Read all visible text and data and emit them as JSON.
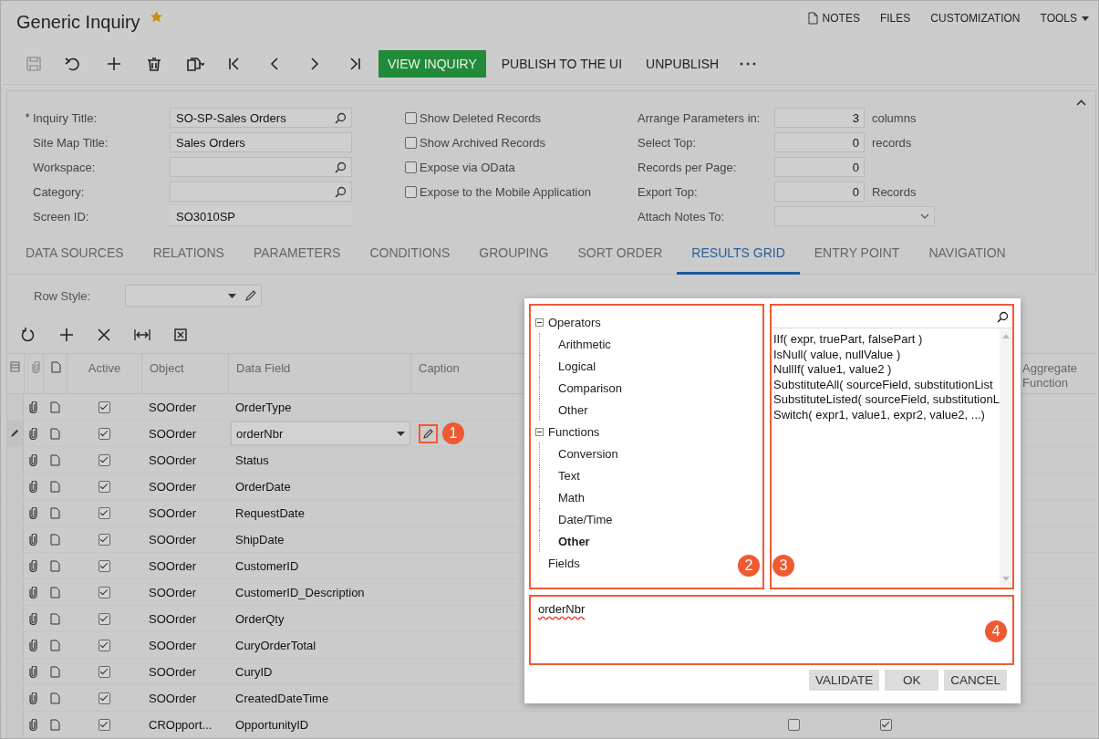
{
  "header": {
    "title": "Generic Inquiry",
    "favorite": true,
    "links": [
      {
        "label": "NOTES",
        "kind": "notes"
      },
      {
        "label": "FILES",
        "kind": "plain"
      },
      {
        "label": "CUSTOMIZATION",
        "kind": "plain"
      },
      {
        "label": "TOOLS",
        "kind": "menu"
      }
    ]
  },
  "toolbar": {
    "icons": [
      {
        "kind": "save",
        "disabled": true
      },
      {
        "kind": "undo",
        "disabled": false
      },
      {
        "kind": "add",
        "disabled": false
      },
      {
        "kind": "delete",
        "disabled": false
      },
      {
        "kind": "paste",
        "disabled": false
      },
      {
        "kind": "first",
        "disabled": false
      },
      {
        "kind": "prev",
        "disabled": false
      },
      {
        "kind": "next",
        "disabled": false
      },
      {
        "kind": "last",
        "disabled": false
      }
    ],
    "actions": [
      {
        "label": "VIEW INQUIRY",
        "kind": "primary"
      },
      {
        "label": "PUBLISH TO THE UI",
        "kind": "plain"
      },
      {
        "label": "UNPUBLISH",
        "kind": "plain"
      },
      {
        "kind": "more"
      }
    ]
  },
  "form": {
    "required_mark": "*",
    "fields": [
      {
        "label": "Inquiry Title:",
        "value": "SO-SP-Sales Orders",
        "required": true,
        "kind": "lookup"
      },
      {
        "label": "Site Map Title:",
        "value": "Sales Orders",
        "required": false,
        "kind": "text"
      },
      {
        "label": "Workspace:",
        "required": false,
        "kind": "lookup"
      },
      {
        "label": "Category:",
        "required": false,
        "kind": "lookup"
      },
      {
        "label": "Screen ID:",
        "value": "SO3010SP",
        "required": false,
        "kind": "readonly"
      }
    ],
    "options": [
      {
        "label": "Show Deleted Records",
        "checked": false
      },
      {
        "label": "Show Archived Records",
        "checked": false
      },
      {
        "label": "Expose via OData",
        "checked": false
      },
      {
        "label": "Expose to the Mobile Application",
        "checked": false
      }
    ],
    "settings": [
      {
        "label": "Arrange Parameters in:",
        "value": "3",
        "unit": "columns",
        "kind": "number"
      },
      {
        "label": "Select Top:",
        "value": "0",
        "unit": "records",
        "kind": "number"
      },
      {
        "label": "Records per Page:",
        "value": "0",
        "kind": "number"
      },
      {
        "label": "Export Top:",
        "value": "0",
        "unit": "Records",
        "kind": "number"
      },
      {
        "label": "Attach Notes To:",
        "kind": "select"
      }
    ]
  },
  "tabs": [
    {
      "label": "DATA SOURCES",
      "selected": false
    },
    {
      "label": "RELATIONS",
      "selected": false
    },
    {
      "label": "PARAMETERS",
      "selected": false
    },
    {
      "label": "CONDITIONS",
      "selected": false
    },
    {
      "label": "GROUPING",
      "selected": false
    },
    {
      "label": "SORT ORDER",
      "selected": false
    },
    {
      "label": "RESULTS GRID",
      "selected": true
    },
    {
      "label": "ENTRY POINT",
      "selected": false
    },
    {
      "label": "NAVIGATION",
      "selected": false
    }
  ],
  "grid": {
    "row_style_label": "Row Style:",
    "columns": [
      "Active",
      "Object",
      "Data Field",
      "Caption",
      "Aggregate Function"
    ],
    "rows": [
      {
        "active": true,
        "object": "SOOrder",
        "data_field": "OrderType",
        "editing": false
      },
      {
        "active": true,
        "object": "SOOrder",
        "data_field": "orderNbr",
        "editing": true,
        "callout": "1"
      },
      {
        "active": true,
        "object": "SOOrder",
        "data_field": "Status",
        "editing": false
      },
      {
        "active": true,
        "object": "SOOrder",
        "data_field": "OrderDate",
        "editing": false
      },
      {
        "active": true,
        "object": "SOOrder",
        "data_field": "RequestDate",
        "editing": false
      },
      {
        "active": true,
        "object": "SOOrder",
        "data_field": "ShipDate",
        "editing": false
      },
      {
        "active": true,
        "object": "SOOrder",
        "data_field": "CustomerID",
        "editing": false
      },
      {
        "active": true,
        "object": "SOOrder",
        "data_field": "CustomerID_Description",
        "editing": false
      },
      {
        "active": true,
        "object": "SOOrder",
        "data_field": "OrderQty",
        "editing": false
      },
      {
        "active": true,
        "object": "SOOrder",
        "data_field": "CuryOrderTotal",
        "editing": false
      },
      {
        "active": true,
        "object": "SOOrder",
        "data_field": "CuryID",
        "editing": false
      },
      {
        "active": true,
        "object": "SOOrder",
        "data_field": "CreatedDateTime",
        "editing": false
      },
      {
        "active": true,
        "object": "CROpport...",
        "data_field": "OpportunityID",
        "editing": false,
        "flags": [
          false,
          true
        ]
      }
    ]
  },
  "dialog": {
    "tree": [
      {
        "label": "Operators",
        "expanded": true,
        "selected": false,
        "children": [
          {
            "label": "Arithmetic",
            "selected": false
          },
          {
            "label": "Logical",
            "selected": false
          },
          {
            "label": "Comparison",
            "selected": false
          },
          {
            "label": "Other",
            "selected": false
          }
        ]
      },
      {
        "label": "Functions",
        "expanded": true,
        "selected": false,
        "children": [
          {
            "label": "Conversion",
            "selected": false
          },
          {
            "label": "Text",
            "selected": false
          },
          {
            "label": "Math",
            "selected": false
          },
          {
            "label": "Date/Time",
            "selected": false
          },
          {
            "label": "Other",
            "selected": true
          }
        ]
      },
      {
        "label": "Fields",
        "selected": false
      }
    ],
    "tree_callout": "2",
    "functions": [
      "IIf( expr, truePart, falsePart )",
      "IsNull( value, nullValue )",
      "NullIf( value1, value2 )",
      "SubstituteAll( sourceField, substitutionList",
      "SubstituteListed( sourceField, substitutionL",
      "Switch( expr1, value1, expr2, value2, ...)"
    ],
    "list_callout": "3",
    "expression": "orderNbr",
    "expression_callout": "4",
    "buttons": [
      "VALIDATE",
      "OK",
      "CANCEL"
    ]
  }
}
